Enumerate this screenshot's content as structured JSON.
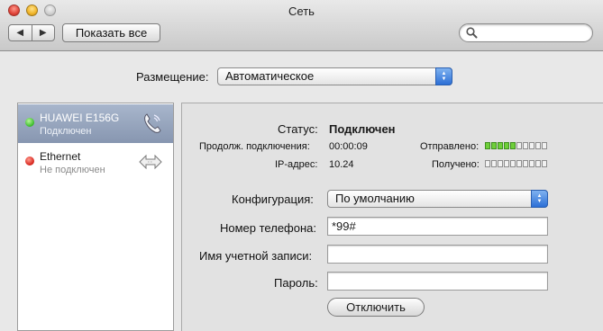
{
  "window": {
    "title": "Сеть"
  },
  "toolbar": {
    "back_glyph": "◀",
    "forward_glyph": "▶",
    "show_all_label": "Показать все",
    "search_placeholder": ""
  },
  "location": {
    "label": "Размещение:",
    "value": "Автоматическое"
  },
  "services": [
    {
      "name": "HUAWEI E156G",
      "status": "Подключен",
      "status_color": "#3fbf2e",
      "icon": "phone-icon",
      "selected": true
    },
    {
      "name": "Ethernet",
      "status": "Не подключен",
      "status_color": "#d9271f",
      "icon": "ethernet-arrows-icon",
      "selected": false
    }
  ],
  "detail": {
    "status_label": "Статус:",
    "status_value": "Подключен",
    "duration_label": "Продолж. подключения:",
    "duration_value": "00:00:09",
    "sent_label": "Отправлено:",
    "sent_level": 0.5,
    "ip_label": "IP-адрес:",
    "ip_value": "10.24",
    "received_label": "Получено:",
    "received_level": 0.0,
    "config_label": "Конфигурация:",
    "config_value": "По умолчанию",
    "phone_label": "Номер телефона:",
    "phone_value": "*99#",
    "account_label": "Имя учетной записи:",
    "account_value": "",
    "password_label": "Пароль:",
    "password_value": "",
    "disconnect_label": "Отключить"
  },
  "colors": {
    "accent": "#2c6fd6",
    "selection": "#8e9cb5",
    "meter_on": "#6fcf3a"
  }
}
